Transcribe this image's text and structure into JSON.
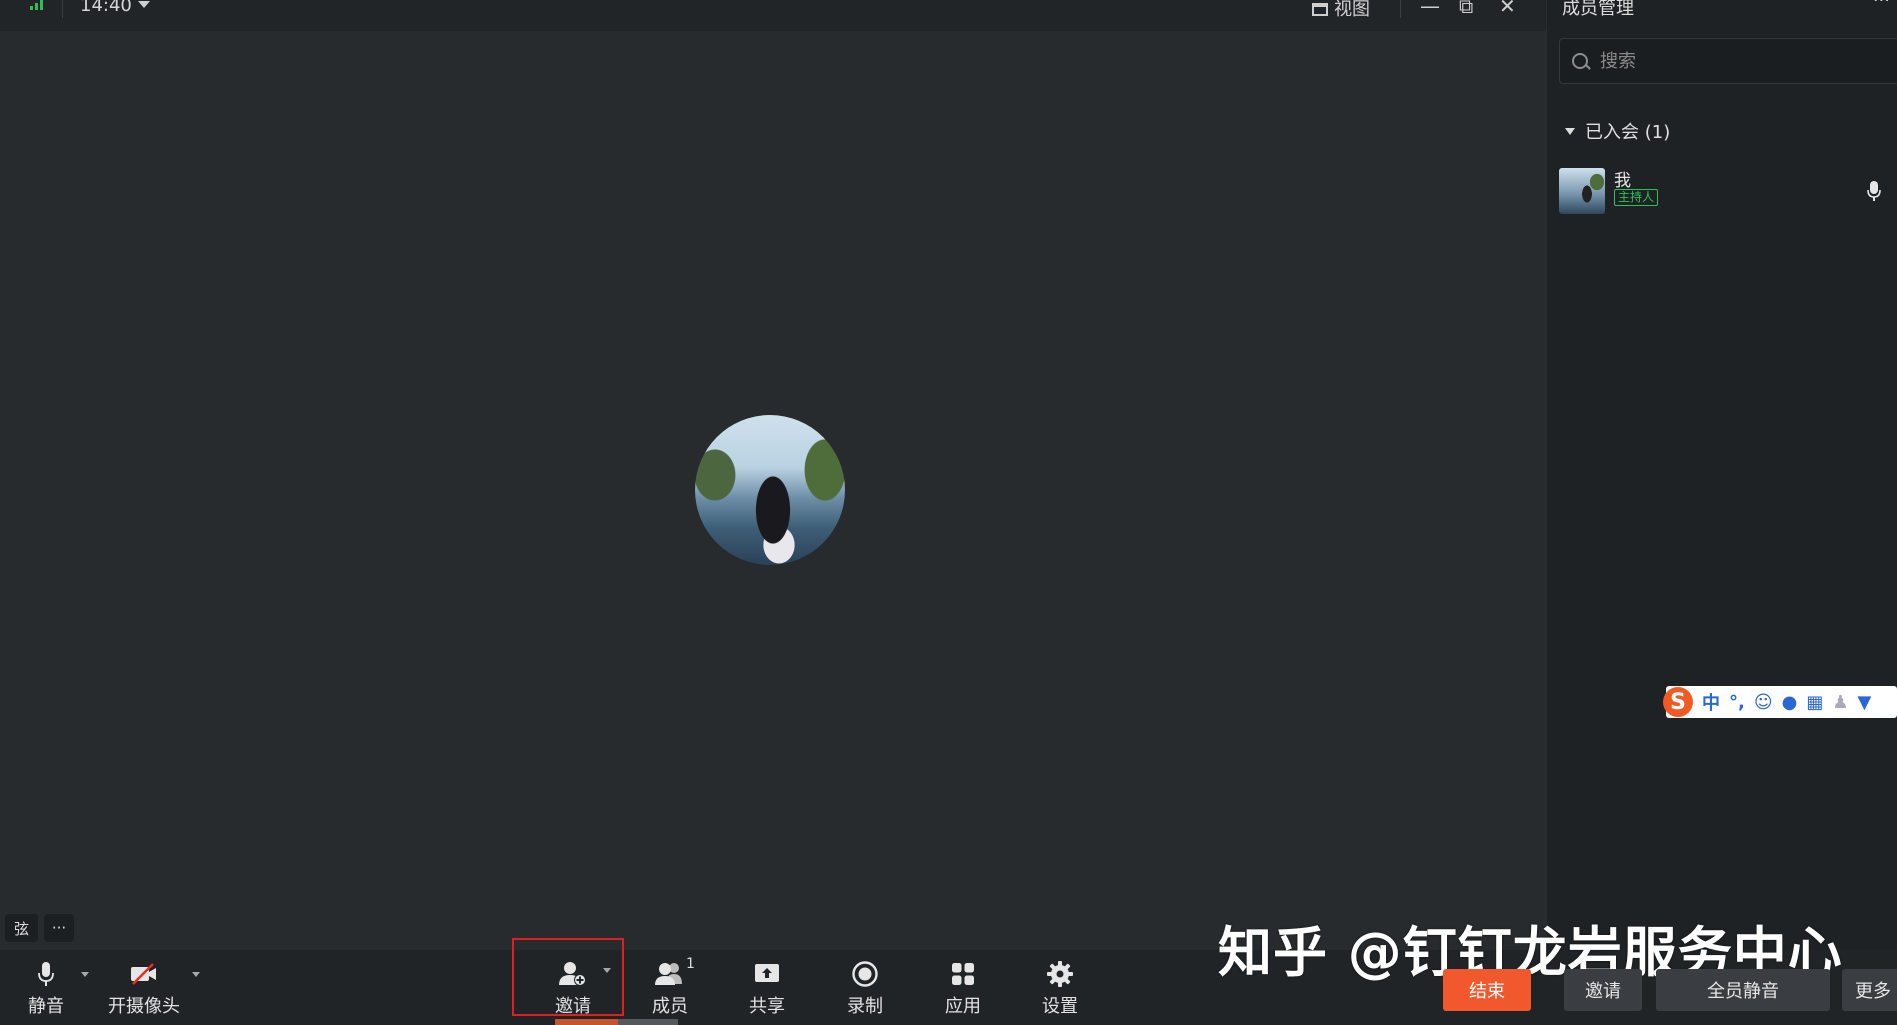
{
  "status": {
    "time": "14:40",
    "view_label": "视图"
  },
  "window_controls": {
    "minimize": "—",
    "restore": "⧉",
    "close": "✕"
  },
  "self_tile": {
    "name_badge": "弦",
    "more_label": "···"
  },
  "toolbar": {
    "mute_label": "静音",
    "camera_label": "开摄像头",
    "invite_label": "邀请",
    "members_label": "成员",
    "members_count": "1",
    "share_label": "共享",
    "record_label": "录制",
    "apps_label": "应用",
    "settings_label": "设置",
    "end_label": "结束",
    "invite_right_label": "邀请",
    "mute_all_label": "全员静音",
    "more_label": "更多"
  },
  "panel": {
    "title": "成员管理",
    "search_placeholder": "搜索",
    "group_label": "已入会 (1)",
    "members": [
      {
        "name": "我",
        "tag": "主持人"
      }
    ]
  },
  "ime": {
    "logo": "S",
    "mode": "中",
    "punct": "°,"
  },
  "watermark": "知乎 @钉钉龙岩服务中心",
  "colors": {
    "accent_end": "#f1582d",
    "host_tag": "#2fc05a",
    "highlight_box": "#e0201e"
  }
}
